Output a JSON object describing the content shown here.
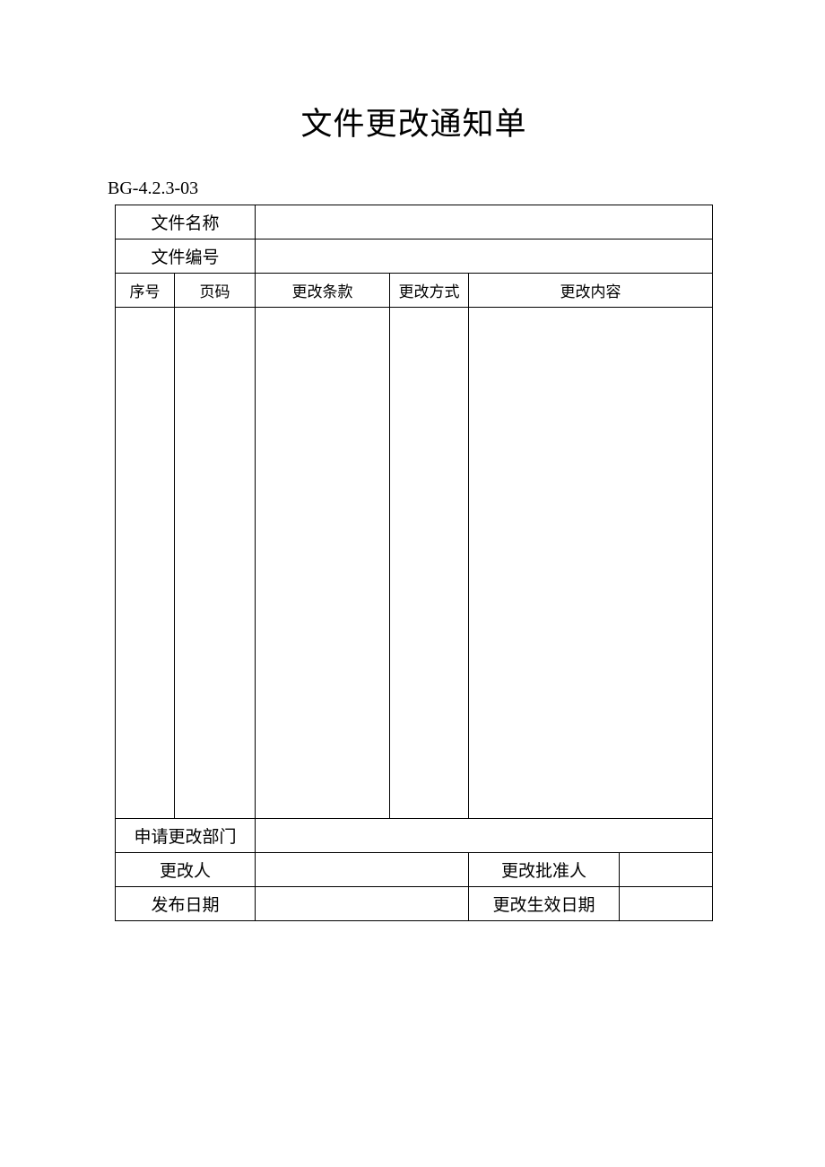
{
  "title": "文件更改通知单",
  "doc_code": "BG-4.2.3-03",
  "labels": {
    "file_name": "文件名称",
    "file_number": "文件编号",
    "seq": "序号",
    "page": "页码",
    "clause": "更改条款",
    "method": "更改方式",
    "content": "更改内容",
    "dept": "申请更改部门",
    "changer": "更改人",
    "approver": "更改批准人",
    "issue_date": "发布日期",
    "effective_date": "更改生效日期"
  },
  "values": {
    "file_name": "",
    "file_number": "",
    "seq": "",
    "page": "",
    "clause": "",
    "method": "",
    "content": "",
    "dept": "",
    "changer": "",
    "approver": "",
    "issue_date": "",
    "effective_date": ""
  }
}
